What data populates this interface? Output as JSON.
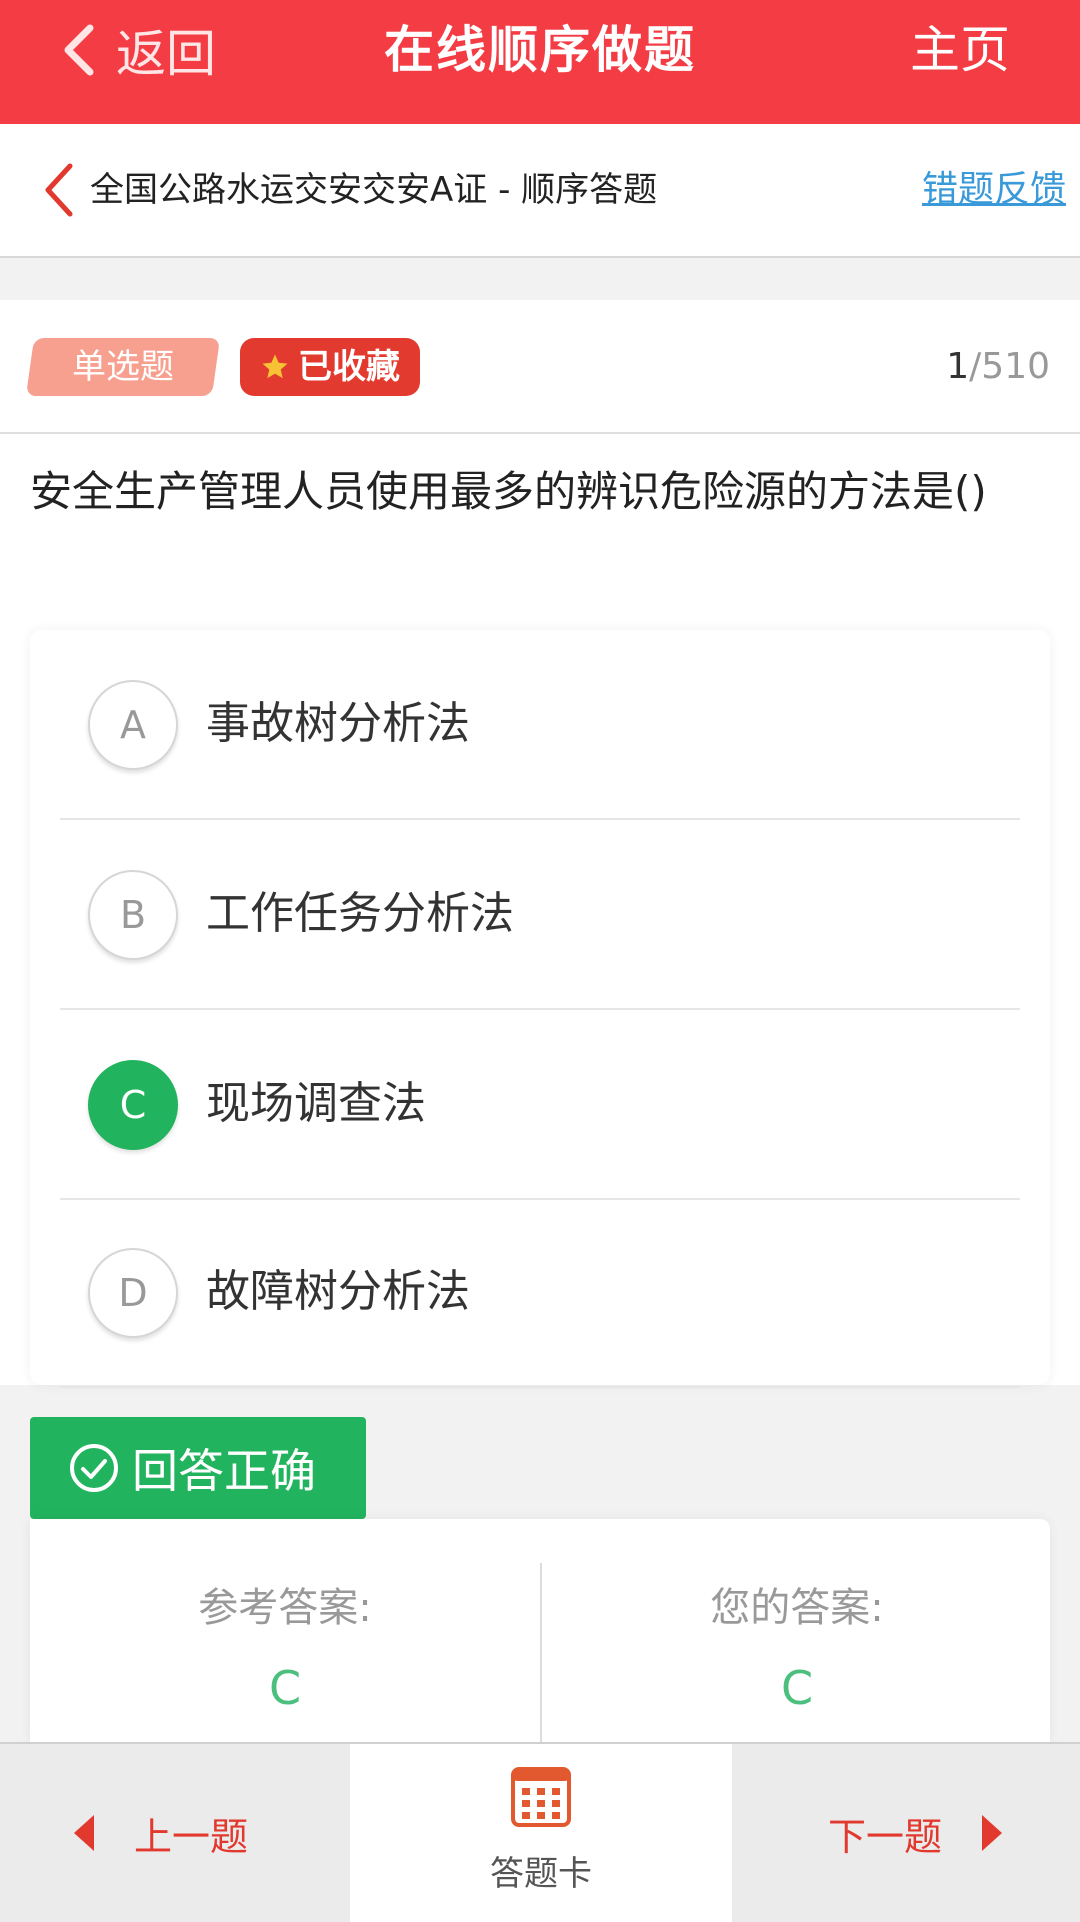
{
  "header": {
    "back_label": "返回",
    "title": "在线顺序做题",
    "home_label": "主页",
    "bg_color": "#f43c44"
  },
  "subheader": {
    "breadcrumb": "全国公路水运交安交安A证 - 顺序答题",
    "feedback_link": "错题反馈"
  },
  "question": {
    "type_tag": "单选题",
    "favorite_tag": "已收藏",
    "current": "1",
    "total": "/510",
    "text": "安全生产管理人员使用最多的辨识危险源的方法是()",
    "options": [
      {
        "letter": "A",
        "text": "事故树分析法",
        "selected": false
      },
      {
        "letter": "B",
        "text": "工作任务分析法",
        "selected": false
      },
      {
        "letter": "C",
        "text": "现场调查法",
        "selected": true
      },
      {
        "letter": "D",
        "text": "故障树分析法",
        "selected": false
      }
    ]
  },
  "result": {
    "status": "回答正确",
    "status_color": "#22b35e",
    "reference_label": "参考答案:",
    "reference_value": "C",
    "your_label": "您的答案:",
    "your_value": "C"
  },
  "bottom": {
    "prev_label": "上一题",
    "card_label": "答题卡",
    "next_label": "下一题",
    "accent_color": "#e2392f"
  }
}
